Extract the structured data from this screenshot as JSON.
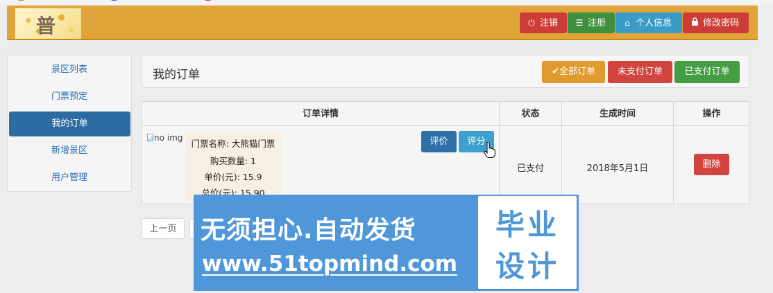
{
  "colors": {
    "header_bg": "#e0a43a",
    "danger": "#d9534f",
    "success": "#449d44",
    "info": "#3a9bc7",
    "warning": "#e19a2f",
    "primary": "#2d6ca2",
    "sidebar_link": "#2a6db5",
    "watermark": "#4f97d9"
  },
  "header": {
    "logo_text": "普",
    "buttons": [
      {
        "label": "注销",
        "icon": "power-icon"
      },
      {
        "label": "注册",
        "icon": "server-icon"
      },
      {
        "label": "个人信息",
        "icon": "home-icon"
      },
      {
        "label": "修改密码",
        "icon": "lock-icon"
      }
    ]
  },
  "sidebar": {
    "items": [
      {
        "label": "景区列表"
      },
      {
        "label": "门票预定"
      },
      {
        "label": "我的订单",
        "active": true
      },
      {
        "label": "新增景区"
      },
      {
        "label": "用户管理"
      }
    ]
  },
  "main": {
    "title": "我的订单",
    "filters": [
      {
        "label": "全部订单",
        "icon": "check-icon"
      },
      {
        "label": "未支付订单"
      },
      {
        "label": "已支付订单"
      }
    ]
  },
  "table": {
    "headers": [
      "订单详情",
      "状态",
      "生成时间",
      "操作"
    ],
    "rows": [
      {
        "image_alt": "no img",
        "ticket_name": "门票名称: 大熊猫门票",
        "quantity": "购买数量: 1",
        "unit_price": "单价(元): 15.9",
        "total_price": "总价(元): 15.90",
        "review_label": "评价",
        "rate_label": "评分",
        "status": "已支付",
        "created": "2018年5月1日",
        "delete_label": "删除"
      }
    ]
  },
  "pager": {
    "prev_label": "上一页"
  },
  "watermark": {
    "slogan": "无须担心.自动发货",
    "url": "www.51topmind.com",
    "side_top": "毕业",
    "side_bottom": "设计"
  }
}
